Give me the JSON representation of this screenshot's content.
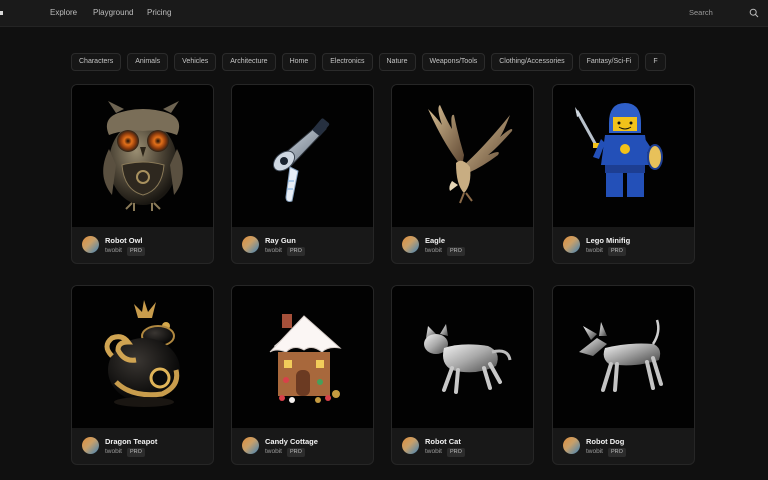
{
  "nav": {
    "links": [
      "Explore",
      "Playground",
      "Pricing"
    ],
    "search_label": "Search"
  },
  "categories": [
    "Characters",
    "Animals",
    "Vehicles",
    "Architecture",
    "Home",
    "Electronics",
    "Nature",
    "Weapons/Tools",
    "Clothing/Accessories",
    "Fantasy/Sci-Fi",
    "F"
  ],
  "models": [
    {
      "title": "Robot Owl",
      "author": "twobit",
      "badge": "PRO",
      "thumb": "owl"
    },
    {
      "title": "Ray Gun",
      "author": "twobit",
      "badge": "PRO",
      "thumb": "raygun"
    },
    {
      "title": "Eagle",
      "author": "twobit",
      "badge": "PRO",
      "thumb": "eagle"
    },
    {
      "title": "Lego Minifig",
      "author": "twobit",
      "badge": "PRO",
      "thumb": "lego"
    },
    {
      "title": "Dragon Teapot",
      "author": "twobit",
      "badge": "PRO",
      "thumb": "teapot"
    },
    {
      "title": "Candy Cottage",
      "author": "twobit",
      "badge": "PRO",
      "thumb": "cottage"
    },
    {
      "title": "Robot Cat",
      "author": "twobit",
      "badge": "PRO",
      "thumb": "cat"
    },
    {
      "title": "Robot Dog",
      "author": "twobit",
      "badge": "PRO",
      "thumb": "dog"
    }
  ],
  "colors": {
    "background": "#101010",
    "card": "#181818",
    "thumb_bg": "#020202",
    "badge_bg": "#2c2c2c"
  }
}
